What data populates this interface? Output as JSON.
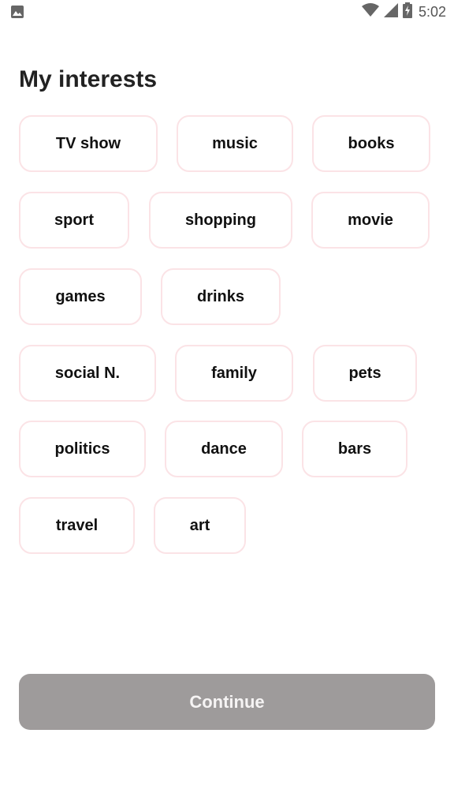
{
  "status_bar": {
    "time": "5:02",
    "icons": [
      "image-notification-icon",
      "wifi-icon",
      "cell-signal-icon",
      "battery-charging-icon"
    ]
  },
  "title": "My interests",
  "interests": {
    "row1": [
      "TV show",
      "music",
      "books"
    ],
    "row2": [
      "sport",
      "shopping",
      "movie"
    ],
    "row3": [
      "games",
      "drinks"
    ],
    "row4": [
      "social N.",
      "family",
      "pets"
    ],
    "row5": [
      "politics",
      "dance",
      "bars"
    ],
    "row6": [
      "travel",
      "art"
    ]
  },
  "continue_label": "Continue",
  "colors": {
    "chip_border": "#fbe3e6",
    "button_bg": "#9e9b9b",
    "button_text": "#f6f4f4"
  }
}
